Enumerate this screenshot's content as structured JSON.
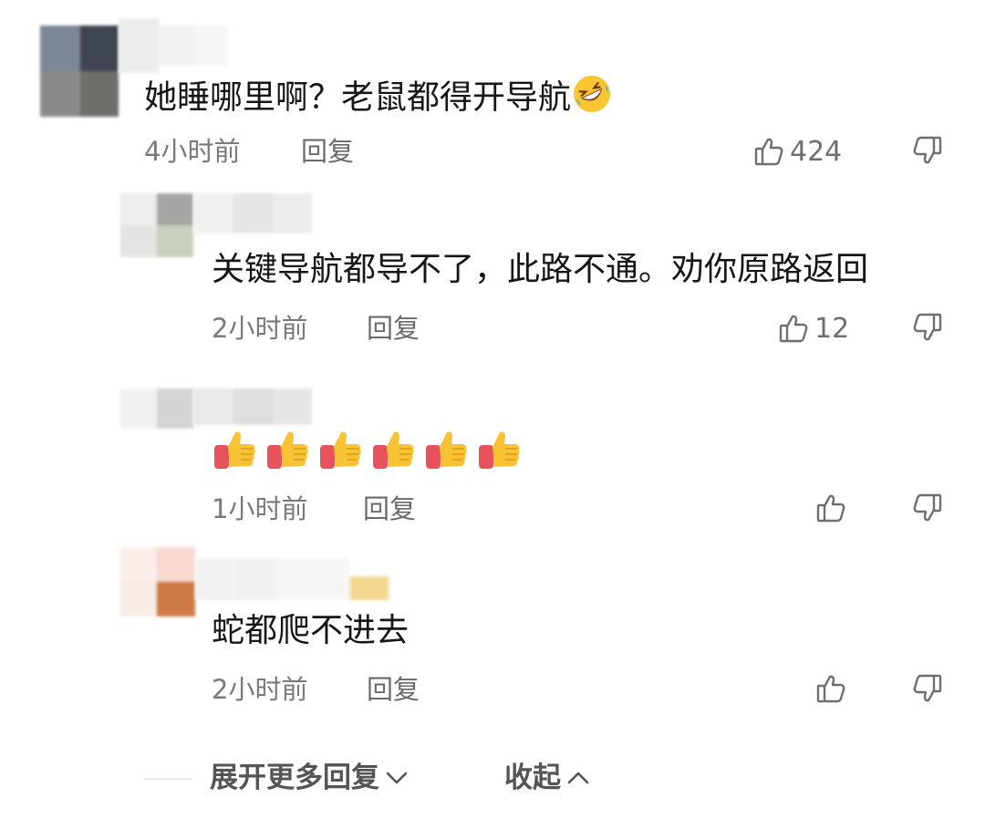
{
  "comments": [
    {
      "text": "她睡哪里啊？老鼠都得开导航",
      "emoji": "rolling-on-floor-laughing-emoji",
      "time": "4小时前",
      "reply": "回复",
      "likes": "424"
    },
    {
      "text": "关键导航都导不了，此路不通。劝你原路返回",
      "time": "2小时前",
      "reply": "回复",
      "likes": "12"
    },
    {
      "text": "",
      "emoji": "thumbs-up-emoji",
      "emoji_count": 6,
      "time": "1小时前",
      "reply": "回复",
      "likes": ""
    },
    {
      "text": "蛇都爬不进去",
      "time": "2小时前",
      "reply": "回复",
      "likes": ""
    }
  ],
  "footer": {
    "expand": "展开更多回复",
    "collapse": "收起"
  },
  "colors": {
    "meta": "#7a7a7a",
    "text": "#161616",
    "thumb_red": "#e8525c",
    "thumb_yellow": "#f7c234"
  }
}
